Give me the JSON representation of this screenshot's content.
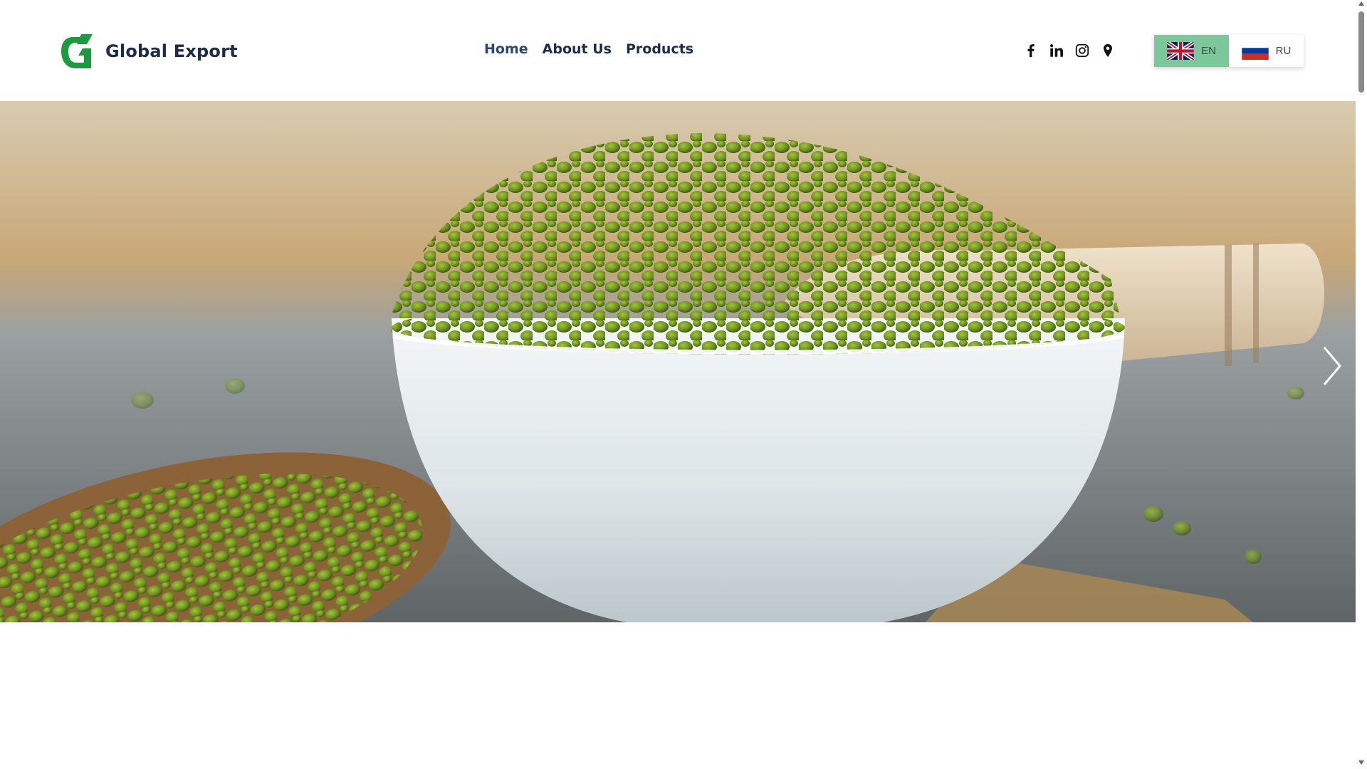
{
  "header": {
    "logo_text": "Global Export",
    "brand_color": "#1b9a3f",
    "nav": [
      {
        "label": "Home",
        "active": true
      },
      {
        "label": "About Us",
        "active": false
      },
      {
        "label": "Products",
        "active": false
      }
    ],
    "social_icons": [
      "facebook-icon",
      "linkedin-icon",
      "instagram-icon",
      "map-pin-icon"
    ],
    "languages": [
      {
        "code": "EN",
        "flag": "uk-flag-icon",
        "active": true
      },
      {
        "code": "RU",
        "flag": "russia-flag-icon",
        "active": false
      }
    ],
    "language_active_color": "#7cc89a"
  },
  "hero": {
    "image": "bowl-of-mung-beans-with-wooden-scoop",
    "next_icon": "chevron-right-icon"
  }
}
